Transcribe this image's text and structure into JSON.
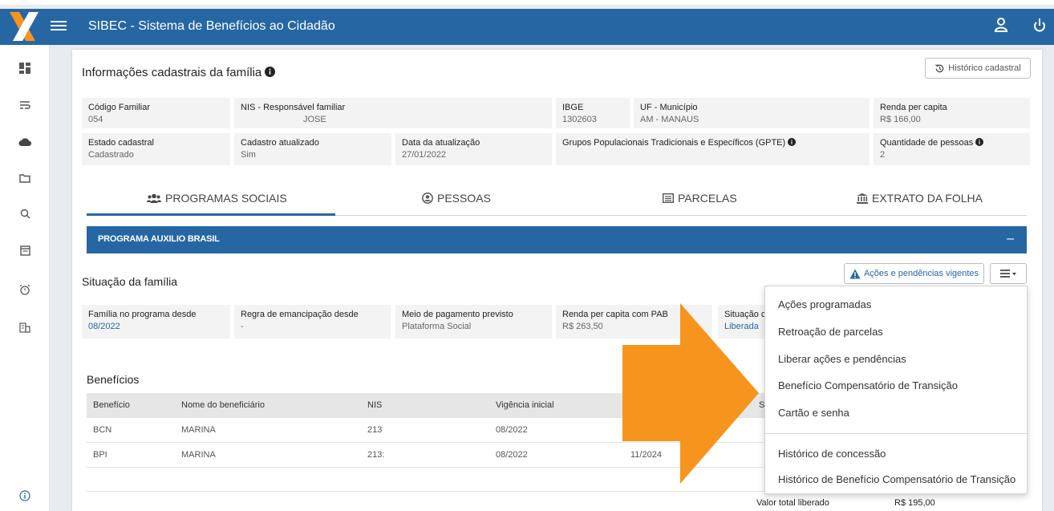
{
  "app": {
    "title": "SIBEC - Sistema de Benefícios ao Cidadão"
  },
  "header": {
    "title": "Informações cadastrais da família",
    "history_button": "Histórico cadastral"
  },
  "family_info": [
    {
      "label": "Código Familiar",
      "value": "054"
    },
    {
      "label": "NIS - Responsável familiar",
      "value": "JOSE"
    },
    {
      "label": "IBGE",
      "value": "1302603"
    },
    {
      "label": "UF - Município",
      "value": "AM - MANAUS"
    },
    {
      "label": "Renda per capita",
      "value": "R$ 166,00"
    },
    {
      "label": "Estado cadastral",
      "value": "Cadastrado"
    },
    {
      "label": "Cadastro atualizado",
      "value": "Sim"
    },
    {
      "label": "Data da atualização",
      "value": "27/01/2022"
    },
    {
      "label": "Grupos Populacionais Tradicionais e Específicos (GPTE)",
      "value": ""
    },
    {
      "label": "Quantidade de pessoas",
      "value": "2"
    }
  ],
  "tabs": [
    {
      "label": "PROGRAMAS SOCIAIS",
      "icon": "users-icon"
    },
    {
      "label": "PESSOAS",
      "icon": "person-circle-icon"
    },
    {
      "label": "PARCELAS",
      "icon": "list-box-icon"
    },
    {
      "label": "EXTRATO DA FOLHA",
      "icon": "bank-icon"
    }
  ],
  "program": {
    "title": "PROGRAMA AUXILIO BRASIL",
    "collapse": "–",
    "situation_title": "Situação da família",
    "actions_button": "Ações e pendências vigentes"
  },
  "situation": [
    {
      "label": "Família no programa desde",
      "value": "08/2022"
    },
    {
      "label": "Regra de emancipação desde",
      "value": "-"
    },
    {
      "label": "Meio de pagamento previsto",
      "value": "Plataforma Social"
    },
    {
      "label": "Renda per capita com PAB",
      "value": "R$ 263,50"
    },
    {
      "label": "Situação c",
      "value": "Liberada"
    }
  ],
  "benefits": {
    "title": "Benefícios",
    "columns": [
      "Benefício",
      "Nome do beneficiário",
      "NIS",
      "Vigência inicial",
      "",
      "Situ"
    ],
    "rows": [
      [
        "BCN",
        "MARINA",
        "213",
        "08/2022",
        "",
        ""
      ],
      [
        "BPI",
        "MARINA",
        "213:",
        "08/2022",
        "11/2024",
        ""
      ]
    ],
    "total_label": "Valor total liberado",
    "total_value": "R$ 195,00"
  },
  "menu": {
    "items": [
      "Ações programadas",
      "Retroação de parcelas",
      "Liberar ações e pendências",
      "Benefício Compensatório de Transição",
      "Cartão e senha",
      "Histórico de concessão",
      "Histórico de Benefício Compensatório de Transição"
    ]
  },
  "colors": {
    "primary": "#2667a3",
    "arrow": "#f7941d"
  }
}
